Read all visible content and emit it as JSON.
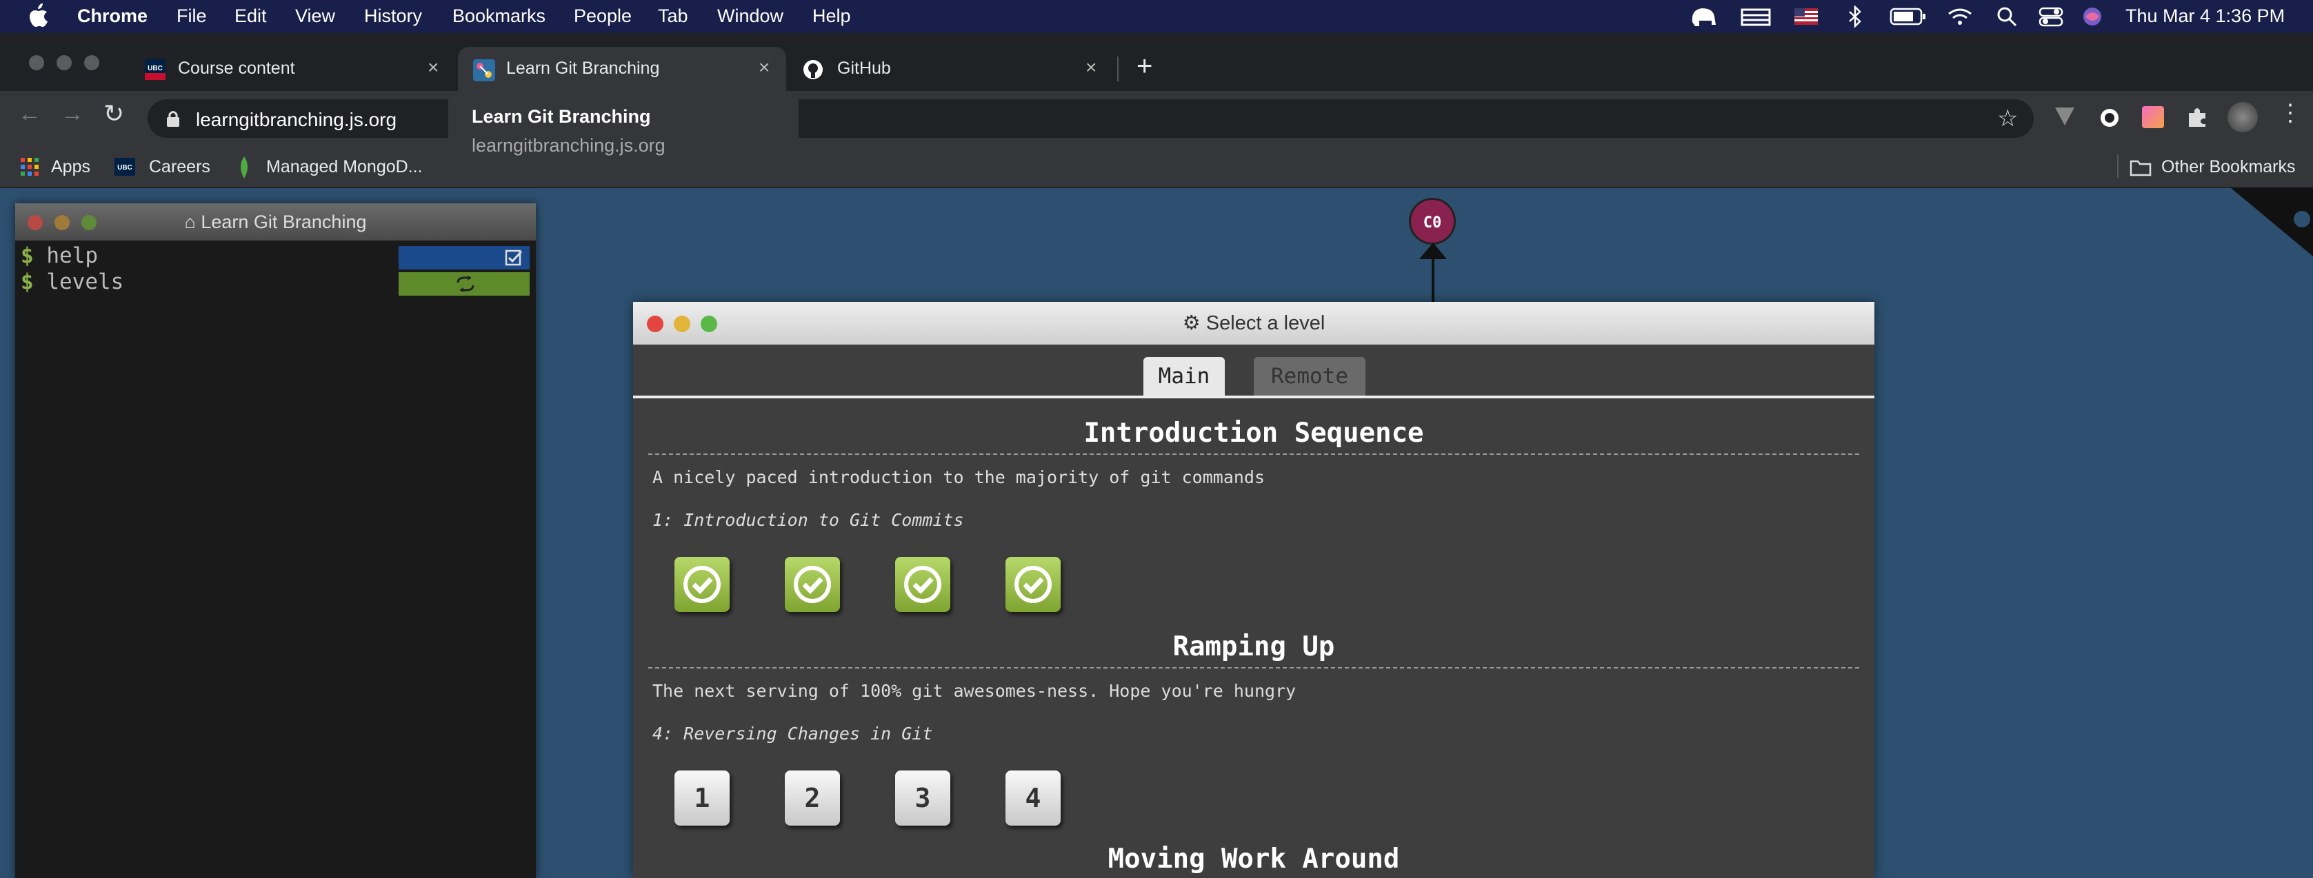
{
  "menubar": {
    "app": "Chrome",
    "items": [
      "File",
      "Edit",
      "View",
      "History",
      "Bookmarks",
      "People",
      "Tab",
      "Window",
      "Help"
    ],
    "clock": "Thu Mar 4  1:36 PM"
  },
  "tabs": [
    {
      "label": "Course content",
      "favicon": "ubc-icon"
    },
    {
      "label": "Learn Git Branching",
      "favicon": "git-branching-icon",
      "active": true
    },
    {
      "label": "GitHub",
      "favicon": "github-icon"
    }
  ],
  "address": {
    "url": "learngitbranching.js.org"
  },
  "tab_hover": {
    "title": "Learn Git Branching",
    "url": "learngitbranching.js.org"
  },
  "bookmarks": {
    "apps": "Apps",
    "careers": "Careers",
    "mongo": "Managed MongoD...",
    "other": "Other Bookmarks"
  },
  "terminal": {
    "title": "Learn Git Branching",
    "prompt": "$",
    "lines": [
      "help",
      "levels"
    ]
  },
  "graph": {
    "commit": "C0"
  },
  "dialog": {
    "title": "Select a level",
    "tabs": {
      "main": "Main",
      "remote": "Remote"
    },
    "sections": [
      {
        "title": "Introduction Sequence",
        "description": "A nicely paced introduction to the majority of git commands",
        "current": "1: Introduction to Git Commits",
        "levels": [
          "1",
          "2",
          "3",
          "4"
        ],
        "completed": [
          true,
          true,
          true,
          true
        ]
      },
      {
        "title": "Ramping Up",
        "description": "The next serving of 100% git awesomes-ness. Hope you're hungry",
        "current": "4: Reversing Changes in Git",
        "levels": [
          "1",
          "2",
          "3",
          "4"
        ],
        "completed": [
          false,
          false,
          false,
          false
        ]
      },
      {
        "title": "Moving Work Around"
      }
    ]
  },
  "colors": {
    "background": "#2d5070",
    "menubar": "#181f4b",
    "completed": "#8fb43c",
    "commit": "#8a2250",
    "terminal_help_bar": "#1a4a8c",
    "terminal_levels_bar": "#5e8a2c"
  }
}
